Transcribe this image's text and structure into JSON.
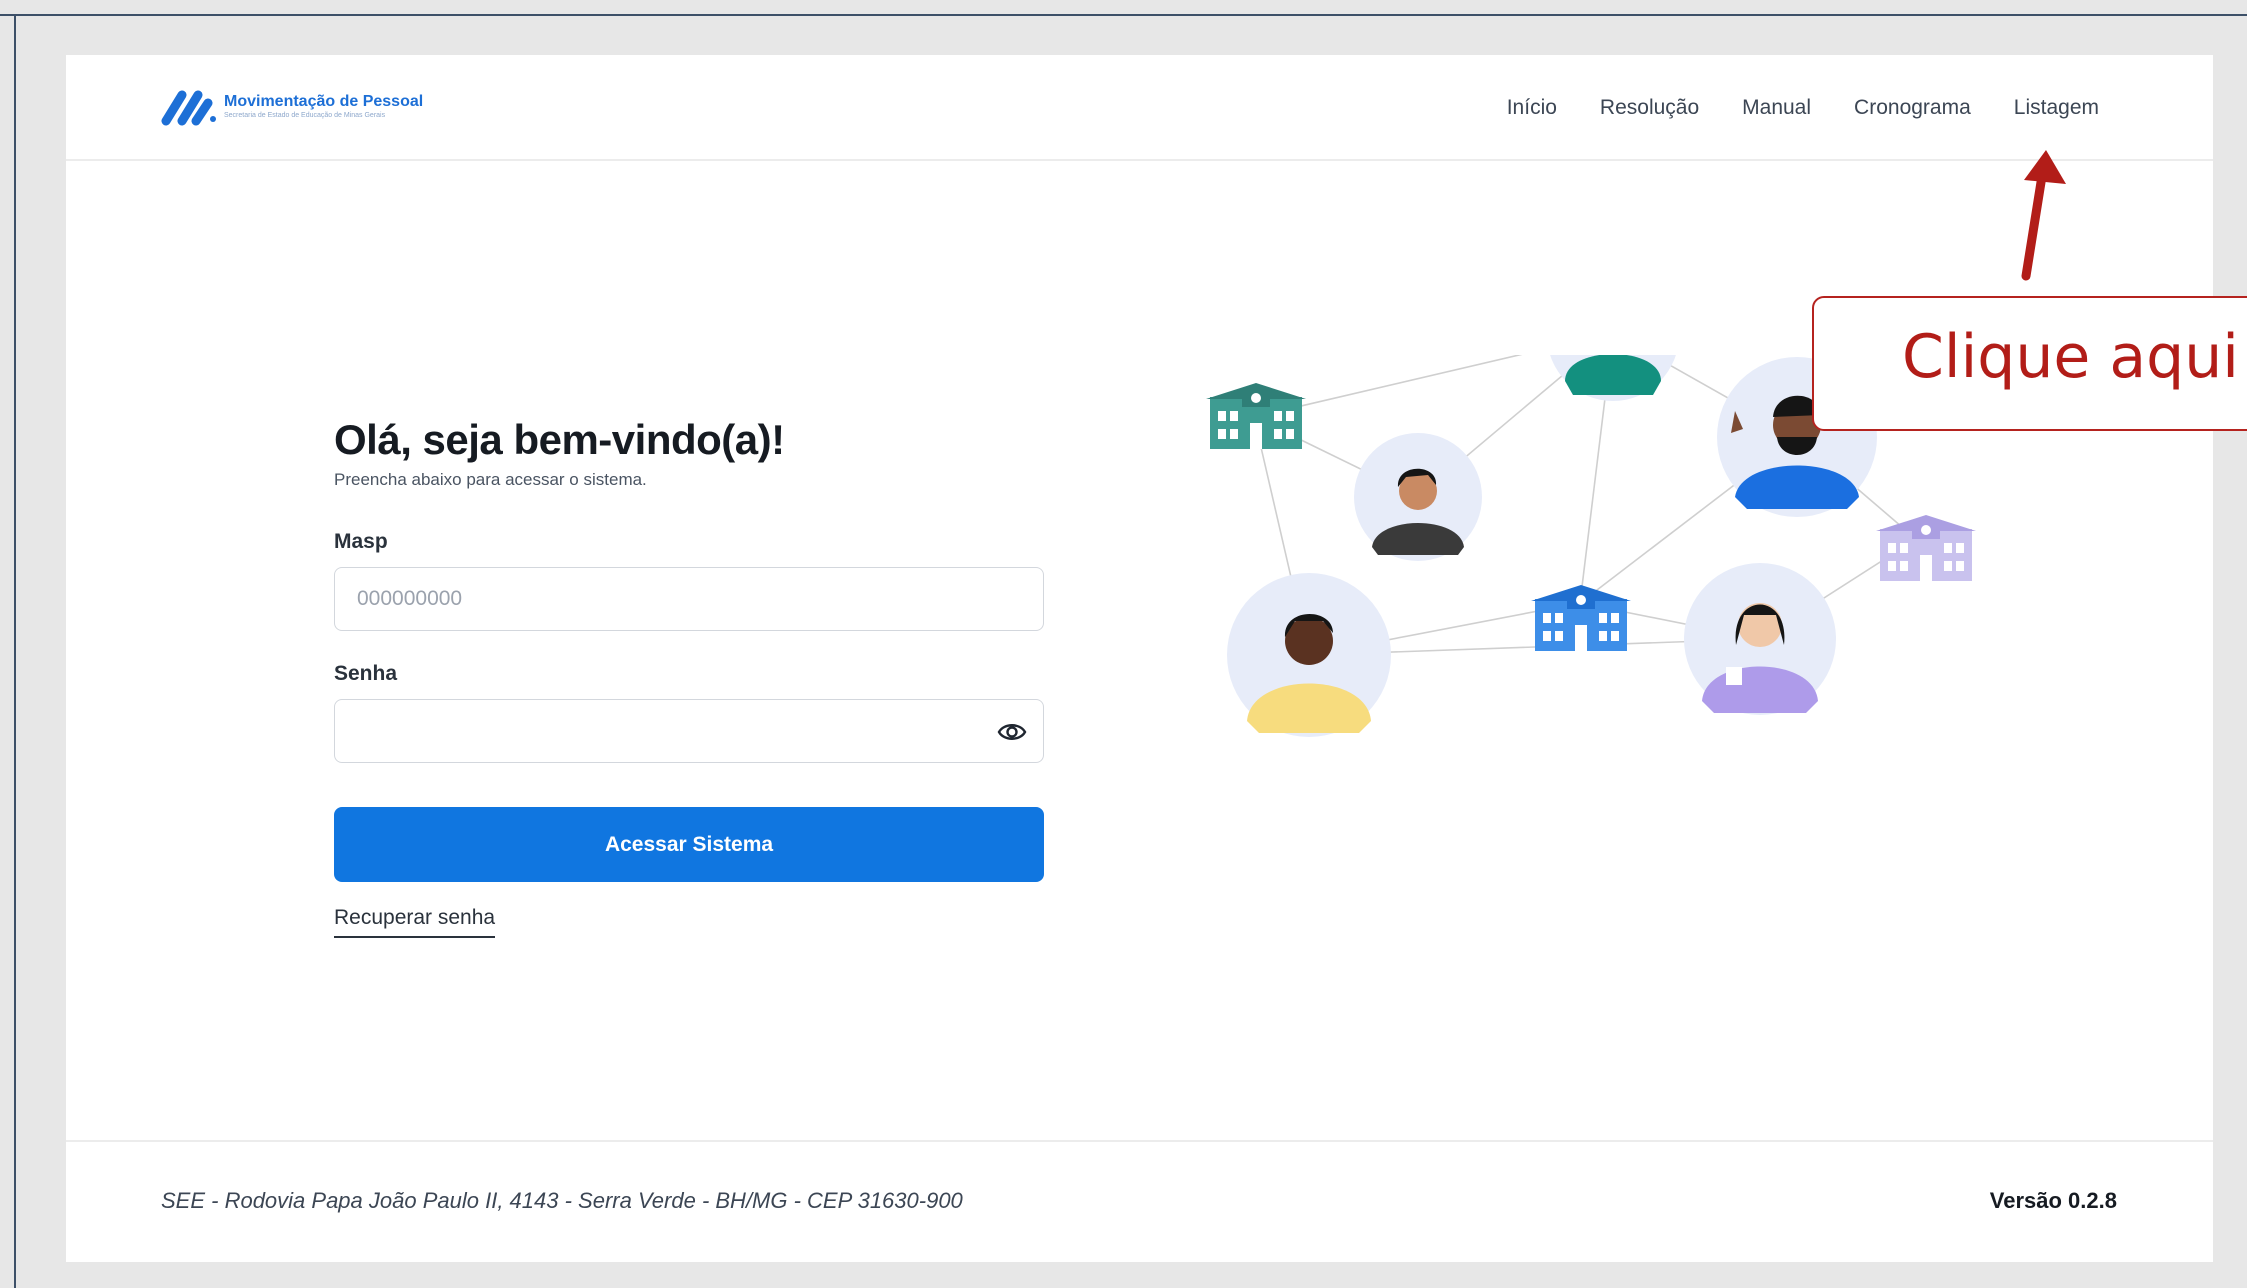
{
  "brand": {
    "title": "Movimentação de Pessoal",
    "subtitle": "Secretaria de Estado de Educação de Minas Gerais",
    "color": "#1d6fd6"
  },
  "nav": {
    "items": [
      {
        "label": "Início"
      },
      {
        "label": "Resolução"
      },
      {
        "label": "Manual"
      },
      {
        "label": "Cronograma"
      },
      {
        "label": "Listagem"
      }
    ]
  },
  "login": {
    "greeting": "Olá, seja bem-vindo(a)!",
    "subtitle": "Preencha abaixo para acessar o sistema.",
    "masp_label": "Masp",
    "masp_placeholder": "000000000",
    "masp_value": "",
    "senha_label": "Senha",
    "senha_value": "",
    "password_toggle_icon": "eye-icon",
    "submit_label": "Acessar Sistema",
    "recover_label": "Recuperar senha",
    "primary_color": "#1076e0"
  },
  "illustration": {
    "icons": [
      "school-building-icon",
      "person-avatar-icon",
      "network-lines"
    ]
  },
  "footer": {
    "address": "SEE - Rodovia Papa João Paulo II, 4143 - Serra Verde - BH/MG - CEP 31630-900",
    "version": "Versão 0.2.8"
  },
  "annotation": {
    "callout_text": "Clique aqui",
    "color": "#b21d18",
    "arrow_icon": "arrow-up-icon"
  }
}
